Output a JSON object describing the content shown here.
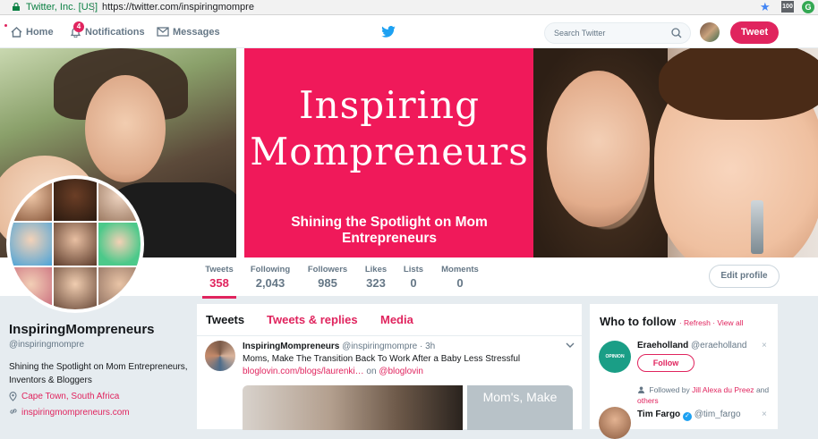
{
  "browser": {
    "site_identity": "Twitter, Inc. [US]",
    "separator": "|",
    "url": "https://twitter.com/inspiringmompre",
    "star_icon": "★",
    "ext1_label": "100",
    "ext2_label": "G"
  },
  "topnav": {
    "home": "Home",
    "notifications": "Notifications",
    "notifications_count": "4",
    "messages": "Messages",
    "search_placeholder": "Search Twitter",
    "tweet_button": "Tweet"
  },
  "banner": {
    "title_line1": "Inspiring",
    "title_line2": "Mompreneurs",
    "subtitle": "Shining the Spotlight on Mom Entrepreneurs"
  },
  "profile_nav": {
    "stats": [
      {
        "label": "Tweets",
        "value": "358"
      },
      {
        "label": "Following",
        "value": "2,043"
      },
      {
        "label": "Followers",
        "value": "985"
      },
      {
        "label": "Likes",
        "value": "323"
      },
      {
        "label": "Lists",
        "value": "0"
      },
      {
        "label": "Moments",
        "value": "0"
      }
    ],
    "edit_profile": "Edit profile"
  },
  "profile": {
    "name": "InspiringMompreneurs",
    "handle": "@inspiringmompre",
    "bio": "Shining the Spotlight on Mom Entrepreneurs, Inventors & Bloggers",
    "location": "Cape Town, South Africa",
    "website": "inspiringmompreneurs.com"
  },
  "timeline": {
    "tabs": [
      "Tweets",
      "Tweets & replies",
      "Media"
    ],
    "tweet": {
      "name": "InspiringMompreneurs",
      "handle_time": "@inspiringmompre · 3h",
      "text": "Moms, Make The Transition Back To Work After a Baby Less Stressful",
      "link1": "bloglovin.com/blogs/laurenki…",
      "link_on": "on",
      "link2": "@bloglovin",
      "image_caption": "Mom's, Make"
    }
  },
  "who_to_follow": {
    "title": "Who to follow",
    "refresh": "Refresh",
    "view_all": "View all",
    "dot": "·",
    "suggestion1": {
      "name": "Eraeholland",
      "handle": "@eraeholland",
      "follow": "Follow",
      "followed_by_prefix": "Followed by",
      "followed_by_names": "Jill Alexa du Preez",
      "followed_by_and": "and",
      "followed_by_others": "others",
      "avatar_text": "OPINION"
    },
    "suggestion2": {
      "name": "Tim Fargo",
      "handle": "@tim_fargo"
    },
    "close": "×"
  },
  "colors": {
    "accent": "#e0245e",
    "brand_pink": "#f0195a",
    "twitter_blue": "#1da1f2"
  }
}
